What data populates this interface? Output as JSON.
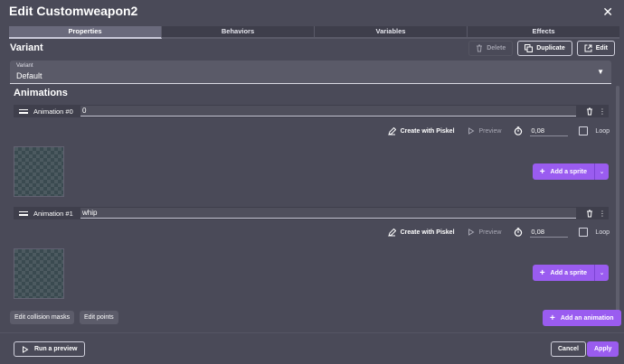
{
  "window": {
    "title": "Edit Customweapon2"
  },
  "tabs": [
    {
      "label": "Properties",
      "active": true
    },
    {
      "label": "Behaviors",
      "active": false
    },
    {
      "label": "Variables",
      "active": false
    },
    {
      "label": "Effects",
      "active": false
    }
  ],
  "variant": {
    "heading": "Variant",
    "delete_label": "Delete",
    "duplicate_label": "Duplicate",
    "edit_label": "Edit",
    "select_label": "Variant",
    "select_value": "Default"
  },
  "animations_heading": "Animations",
  "animations": [
    {
      "label": "Animation #0",
      "name": "0",
      "create_with_piskel": "Create with Piskel",
      "preview": "Preview",
      "fps": "0,08",
      "loop_label": "Loop",
      "loop_checked": false,
      "add_sprite": "Add a sprite"
    },
    {
      "label": "Animation #1",
      "name": "whip",
      "create_with_piskel": "Create with Piskel",
      "preview": "Preview",
      "fps": "0,08",
      "loop_label": "Loop",
      "loop_checked": false,
      "add_sprite": "Add a sprite"
    }
  ],
  "footer": {
    "edit_collision_masks": "Edit collision masks",
    "edit_points": "Edit points",
    "add_animation": "Add an animation",
    "run_preview": "Run a preview",
    "cancel": "Cancel",
    "apply": "Apply"
  },
  "colors": {
    "background": "#4a4a58",
    "accent": "#9a5cf0"
  }
}
